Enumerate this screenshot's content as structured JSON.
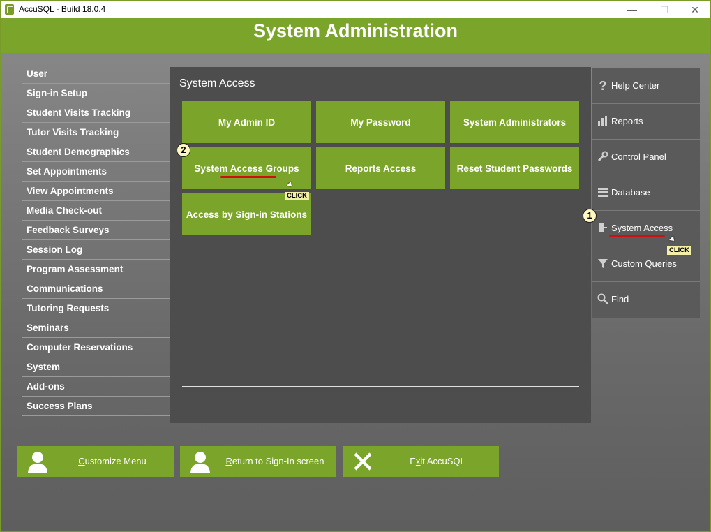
{
  "window": {
    "title": "AccuSQL - Build 18.0.4",
    "controls": {
      "minimize": "—",
      "maximize": "☐",
      "close": "✕"
    }
  },
  "header": {
    "title": "System Administration"
  },
  "left_menu": {
    "items": [
      {
        "label": "User"
      },
      {
        "label": "Sign-in Setup"
      },
      {
        "label": "Student Visits Tracking"
      },
      {
        "label": "Tutor Visits Tracking"
      },
      {
        "label": "Student Demographics"
      },
      {
        "label": "Set Appointments"
      },
      {
        "label": "View Appointments"
      },
      {
        "label": "Media Check-out"
      },
      {
        "label": "Feedback Surveys"
      },
      {
        "label": "Session Log"
      },
      {
        "label": "Program Assessment"
      },
      {
        "label": "Communications"
      },
      {
        "label": "Tutoring Requests"
      },
      {
        "label": "Seminars"
      },
      {
        "label": "Computer Reservations"
      },
      {
        "label": "System"
      },
      {
        "label": "Add-ons"
      },
      {
        "label": "Success Plans"
      }
    ]
  },
  "panel": {
    "title": "System Access",
    "buttons": [
      {
        "label": "My Admin ID"
      },
      {
        "label": "My Password"
      },
      {
        "label": "System Administrators"
      },
      {
        "label": "System Access Groups"
      },
      {
        "label": "Reports Access"
      },
      {
        "label": "Reset Student Passwords"
      },
      {
        "label": "Access by Sign-in Stations"
      }
    ]
  },
  "right_menu": {
    "items": [
      {
        "label": "Help Center",
        "icon": "question-icon"
      },
      {
        "label": "Reports",
        "icon": "bar-chart-icon"
      },
      {
        "label": "Control Panel",
        "icon": "wrench-icon"
      },
      {
        "label": "Database",
        "icon": "database-icon"
      },
      {
        "label": "System Access",
        "icon": "door-icon"
      },
      {
        "label": "Custom Queries",
        "icon": "filter-icon"
      },
      {
        "label": "Find",
        "icon": "search-icon"
      }
    ]
  },
  "bottom_buttons": [
    {
      "label_underlined": "C",
      "label_rest": "ustomize Menu",
      "icon": "user-icon"
    },
    {
      "label_underlined": "R",
      "label_rest": "eturn to Sign-In screen",
      "icon": "user-icon"
    },
    {
      "label_pre": "E",
      "label_underlined": "x",
      "label_rest": "it AccuSQL",
      "icon": "close-x-icon"
    }
  ],
  "annotations": {
    "step1": "1",
    "step2": "2",
    "click_tag": "CLICK"
  },
  "colors": {
    "accent_green": "#7aa52a",
    "panel_bg": "#4d4d4d",
    "highlight_red": "#d01010"
  }
}
